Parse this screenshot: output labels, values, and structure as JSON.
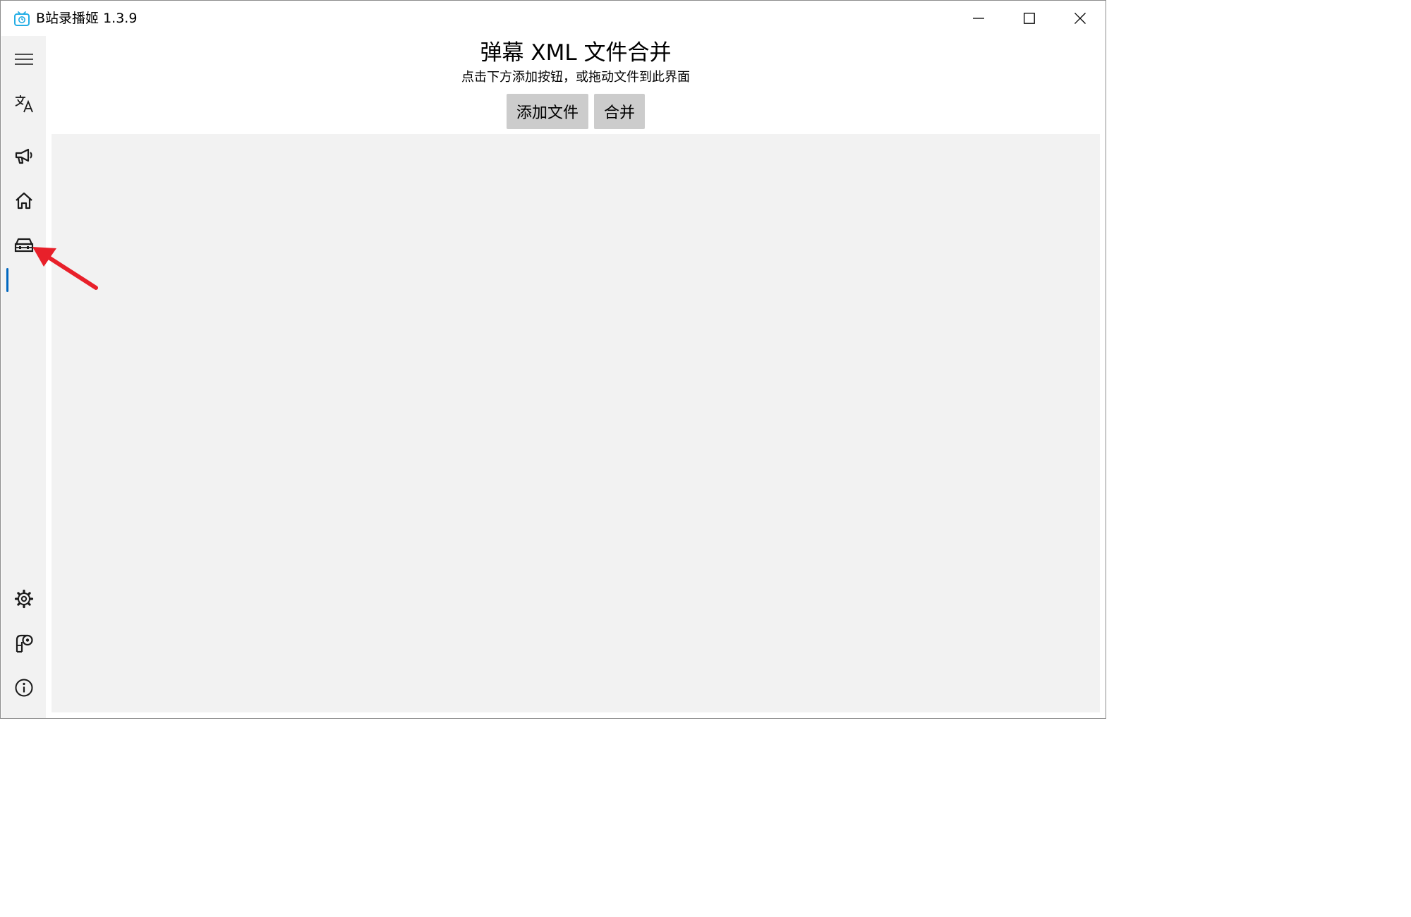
{
  "window": {
    "title": "B站录播姬 1.3.9",
    "controls": {
      "minimize_icon": "minimize-icon",
      "maximize_icon": "maximize-icon",
      "close_icon": "close-icon"
    }
  },
  "sidebar": {
    "items": [
      {
        "icon": "hamburger-menu-icon",
        "selected": false
      },
      {
        "icon": "translate-icon",
        "selected": false
      },
      {
        "icon": "megaphone-icon",
        "selected": false
      },
      {
        "icon": "home-icon",
        "selected": false
      },
      {
        "icon": "toolbox-icon",
        "selected": true
      },
      {
        "icon": "gear-icon",
        "selected": false
      },
      {
        "icon": "log-viewer-icon",
        "selected": false
      },
      {
        "icon": "info-icon",
        "selected": false
      }
    ],
    "selected_indicator_color": "#0067c0"
  },
  "main": {
    "title": "弹幕 XML 文件合并",
    "subtitle": "点击下方添加按钮，或拖动文件到此界面",
    "buttons": {
      "add_files": "添加文件",
      "merge": "合并"
    },
    "file_list": {
      "items": []
    }
  },
  "annotation": {
    "arrow_color": "#e8202a",
    "points_to": "toolbox-icon"
  },
  "colors": {
    "sidebar_bg": "#f2f2f2",
    "list_bg": "#f2f2f2",
    "button_bg": "#cccccc",
    "accent": "#0067c0",
    "app_icon": "#23ade5"
  }
}
